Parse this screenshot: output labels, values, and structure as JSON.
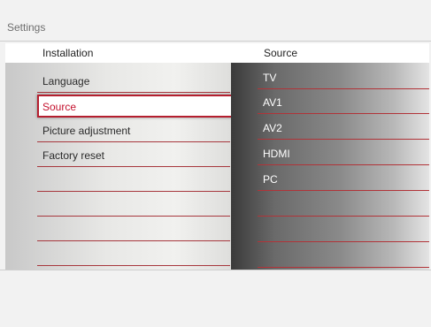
{
  "header": {
    "title": "Settings",
    "left_column": "Installation",
    "right_column": "Source"
  },
  "menu": {
    "items": [
      "Language",
      "Source",
      "Picture adjustment",
      "Factory reset"
    ],
    "selected_index": 1
  },
  "sources": {
    "items": [
      "TV",
      "AV1",
      "AV2",
      "HDMI",
      "PC"
    ]
  },
  "colors": {
    "accent": "#b51f2f",
    "selected_text": "#c4122e"
  }
}
